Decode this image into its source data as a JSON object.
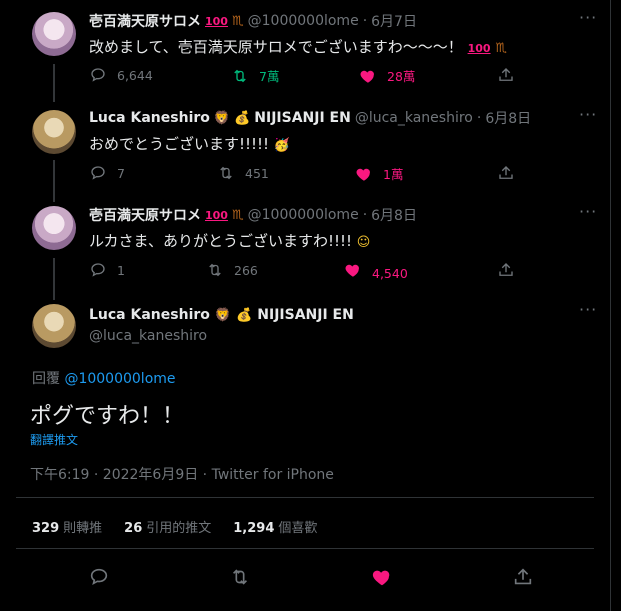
{
  "tweets": [
    {
      "display_name": "壱百満天原サロメ",
      "handle": "@1000000lome",
      "date": "6月7日",
      "text": "改めまして、壱百満天原サロメでございますわ〜〜〜！",
      "replies": "6,644",
      "retweets": "7萬",
      "likes": "28萬"
    },
    {
      "display_name": "Luca Kaneshiro",
      "name_suffix": "NIJISANJI EN",
      "handle": "@luca_kaneshiro",
      "date": "6月8日",
      "text": "おめでとうございます!!!!!",
      "replies": "7",
      "retweets": "451",
      "likes": "1萬"
    },
    {
      "display_name": "壱百満天原サロメ",
      "handle": "@1000000lome",
      "date": "6月8日",
      "text": "ルカさま、ありがとうございますわ!!!!",
      "replies": "1",
      "retweets": "266",
      "likes": "4,540"
    }
  ],
  "main": {
    "display_name": "Luca Kaneshiro",
    "name_suffix": "NIJISANJI EN",
    "handle": "@luca_kaneshiro",
    "reply_label": "回覆",
    "reply_mention": "@1000000lome",
    "text": "ポグですわ！！",
    "translate": "翻譯推文",
    "timestamp": "下午6:19 · 2022年6月9日 · Twitter for iPhone",
    "retweets_count": "329",
    "retweets_label": "則轉推",
    "quotes_count": "26",
    "quotes_label": "引用的推文",
    "likes_count": "1,294",
    "likes_label": "個喜歡"
  },
  "separator": "·",
  "colors": {
    "background": "#000000",
    "text": "#e7e9ea",
    "muted": "#71767b",
    "accent": "#1d9bf0",
    "retweet_green": "#00ba7c",
    "like_pink": "#f91880"
  }
}
